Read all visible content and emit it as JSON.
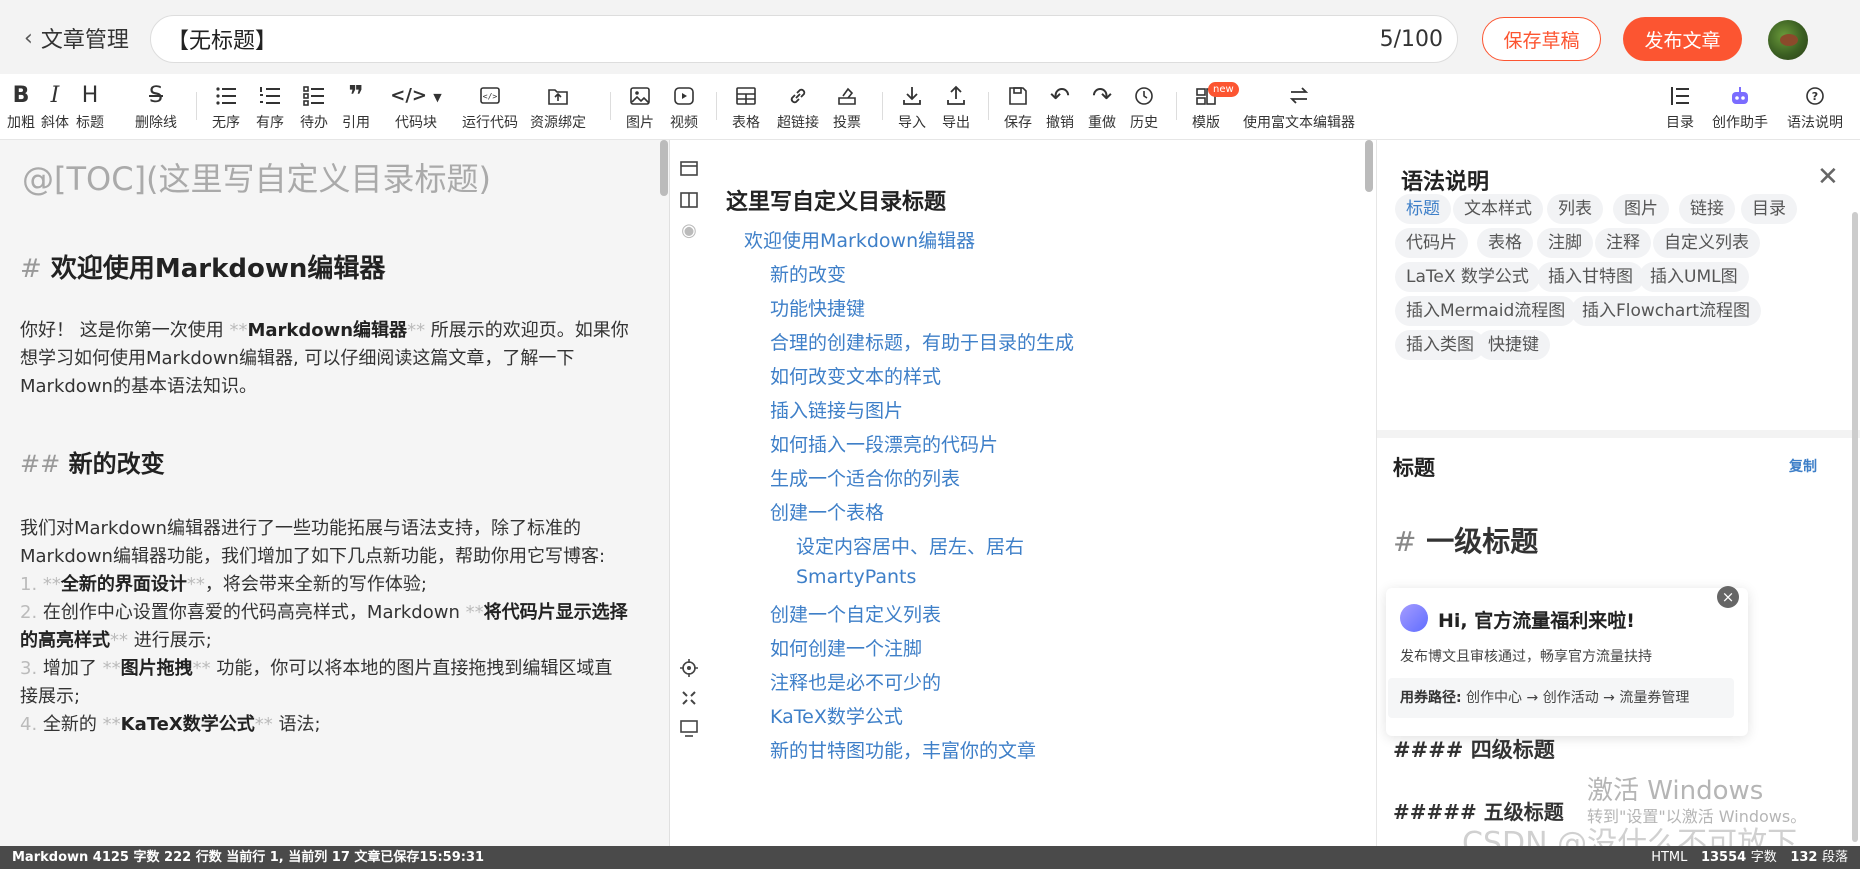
{
  "header": {
    "back_label": "文章管理",
    "title_value": "【无标题】",
    "title_count": "5/100",
    "save_draft": "保存草稿",
    "publish": "发布文章"
  },
  "toolbar": {
    "items": [
      {
        "icon": "B",
        "label": "加粗"
      },
      {
        "icon": "I",
        "label": "斜体"
      },
      {
        "icon": "H",
        "label": "标题"
      },
      {
        "icon": "S",
        "label": "删除线"
      },
      {
        "icon": "ul",
        "label": "无序"
      },
      {
        "icon": "ol",
        "label": "有序"
      },
      {
        "icon": "todo",
        "label": "待办"
      },
      {
        "icon": "❞",
        "label": "引用"
      },
      {
        "icon": "</>",
        "label": "代码块"
      },
      {
        "icon": "run",
        "label": "运行代码"
      },
      {
        "icon": "bind",
        "label": "资源绑定"
      },
      {
        "icon": "img",
        "label": "图片"
      },
      {
        "icon": "video",
        "label": "视频"
      },
      {
        "icon": "table",
        "label": "表格"
      },
      {
        "icon": "link",
        "label": "超链接"
      },
      {
        "icon": "vote",
        "label": "投票"
      },
      {
        "icon": "import",
        "label": "导入"
      },
      {
        "icon": "export",
        "label": "导出"
      },
      {
        "icon": "save",
        "label": "保存"
      },
      {
        "icon": "undo",
        "label": "撤销"
      },
      {
        "icon": "redo",
        "label": "重做"
      },
      {
        "icon": "history",
        "label": "历史"
      },
      {
        "icon": "template",
        "label": "模版"
      },
      {
        "icon": "rich",
        "label": "使用富文本编辑器"
      },
      {
        "icon": "toc",
        "label": "目录"
      },
      {
        "icon": "robot",
        "label": "创作助手"
      },
      {
        "icon": "help",
        "label": "语法说明"
      }
    ],
    "new_badge": "new"
  },
  "editor": {
    "toc_line": "@[TOC](这里写自定义目录标题)",
    "h1_mark": "#",
    "h1_text": "欢迎使用Markdown编辑器",
    "p1_l1a": "你好！ 这是你第一次使用 ",
    "p1_l1b": "Markdown编辑器",
    "p1_l1c": " 所展示的欢迎页。如果你",
    "p1_l2": "想学习如何使用Markdown编辑器, 可以仔细阅读这篇文章，了解一下",
    "p1_l3": "Markdown的基本语法知识。",
    "h2_mark": "##",
    "h2_text": "新的改变",
    "p2_l1": "我们对Markdown编辑器进行了一些功能拓展与语法支持，除了标准的",
    "p2_l2": "Markdown编辑器功能，我们增加了如下几点新功能，帮助你用它写博客:",
    "li1_num": "1.",
    "li1_b": "全新的界面设计",
    "li1_rest": "，将会带来全新的写作体验;",
    "li2_num": "2.",
    "li2_a": "在创作中心设置你喜爱的代码高亮样式，Markdown ",
    "li2_b": "将代码片显示选择",
    "li2_c": "的高亮样式",
    "li2_d": " 进行展示;",
    "li3_num": "3.",
    "li3_a": "增加了 ",
    "li3_b": "图片拖拽",
    "li3_c": " 功能，你可以将本地的图片直接拖拽到编辑区域直",
    "li3_d": "接展示;",
    "li4_num": "4.",
    "li4_a": "全新的 ",
    "li4_b": "KaTeX数学公式",
    "li4_c": " 语法;"
  },
  "preview": {
    "title": "这里写自定义目录标题",
    "toc": [
      {
        "text": "欢迎使用Markdown编辑器",
        "level": 1
      },
      {
        "text": "新的改变",
        "level": 2
      },
      {
        "text": "功能快捷键",
        "level": 2
      },
      {
        "text": "合理的创建标题，有助于目录的生成",
        "level": 2
      },
      {
        "text": "如何改变文本的样式",
        "level": 2
      },
      {
        "text": "插入链接与图片",
        "level": 2
      },
      {
        "text": "如何插入一段漂亮的代码片",
        "level": 2
      },
      {
        "text": "生成一个适合你的列表",
        "level": 2
      },
      {
        "text": "创建一个表格",
        "level": 2
      },
      {
        "text": "设定内容居中、居左、居右",
        "level": 3
      },
      {
        "text": "SmartyPants",
        "level": 3
      },
      {
        "text": "创建一个自定义列表",
        "level": 2
      },
      {
        "text": "如何创建一个注脚",
        "level": 2
      },
      {
        "text": "注释也是必不可少的",
        "level": 2
      },
      {
        "text": "KaTeX数学公式",
        "level": 2
      },
      {
        "text": "新的甘特图功能，丰富你的文章",
        "level": 2
      }
    ]
  },
  "grammar": {
    "title": "语法说明",
    "tags": [
      "标题",
      "文本样式",
      "列表",
      "图片",
      "链接",
      "目录",
      "代码片",
      "表格",
      "注脚",
      "注释",
      "自定义列表",
      "LaTeX 数学公式",
      "插入甘特图",
      "插入UML图",
      "插入Mermaid流程图",
      "插入Flowchart流程图",
      "插入类图",
      "快捷键"
    ],
    "section_title": "标题",
    "copy": "复制",
    "ex1_mark": "#",
    "ex1_text": "一级标题",
    "ex4": "#### 四级标题",
    "ex5": "##### 五级标题"
  },
  "promo": {
    "headline": "Hi, 官方流量福利来啦!",
    "desc": "发布博文且审核通过，畅享官方流量扶持",
    "path_label": "用券路径:",
    "path_value": " 创作中心 → 创作活动 → 流量券管理",
    "close": "×"
  },
  "watermark": {
    "win_title": "激活 Windows",
    "win_sub": "转到\"设置\"以激活 Windows。",
    "csdn": "CSDN @没什么不可放下"
  },
  "status": {
    "left": "Markdown  4125 字数  222 行数  当前行 1, 当前列 17  文章已保存15:59:31",
    "right_a": "HTML",
    "right_b": "13554",
    "right_c": "字数",
    "right_d": "132",
    "right_e": "段落"
  }
}
